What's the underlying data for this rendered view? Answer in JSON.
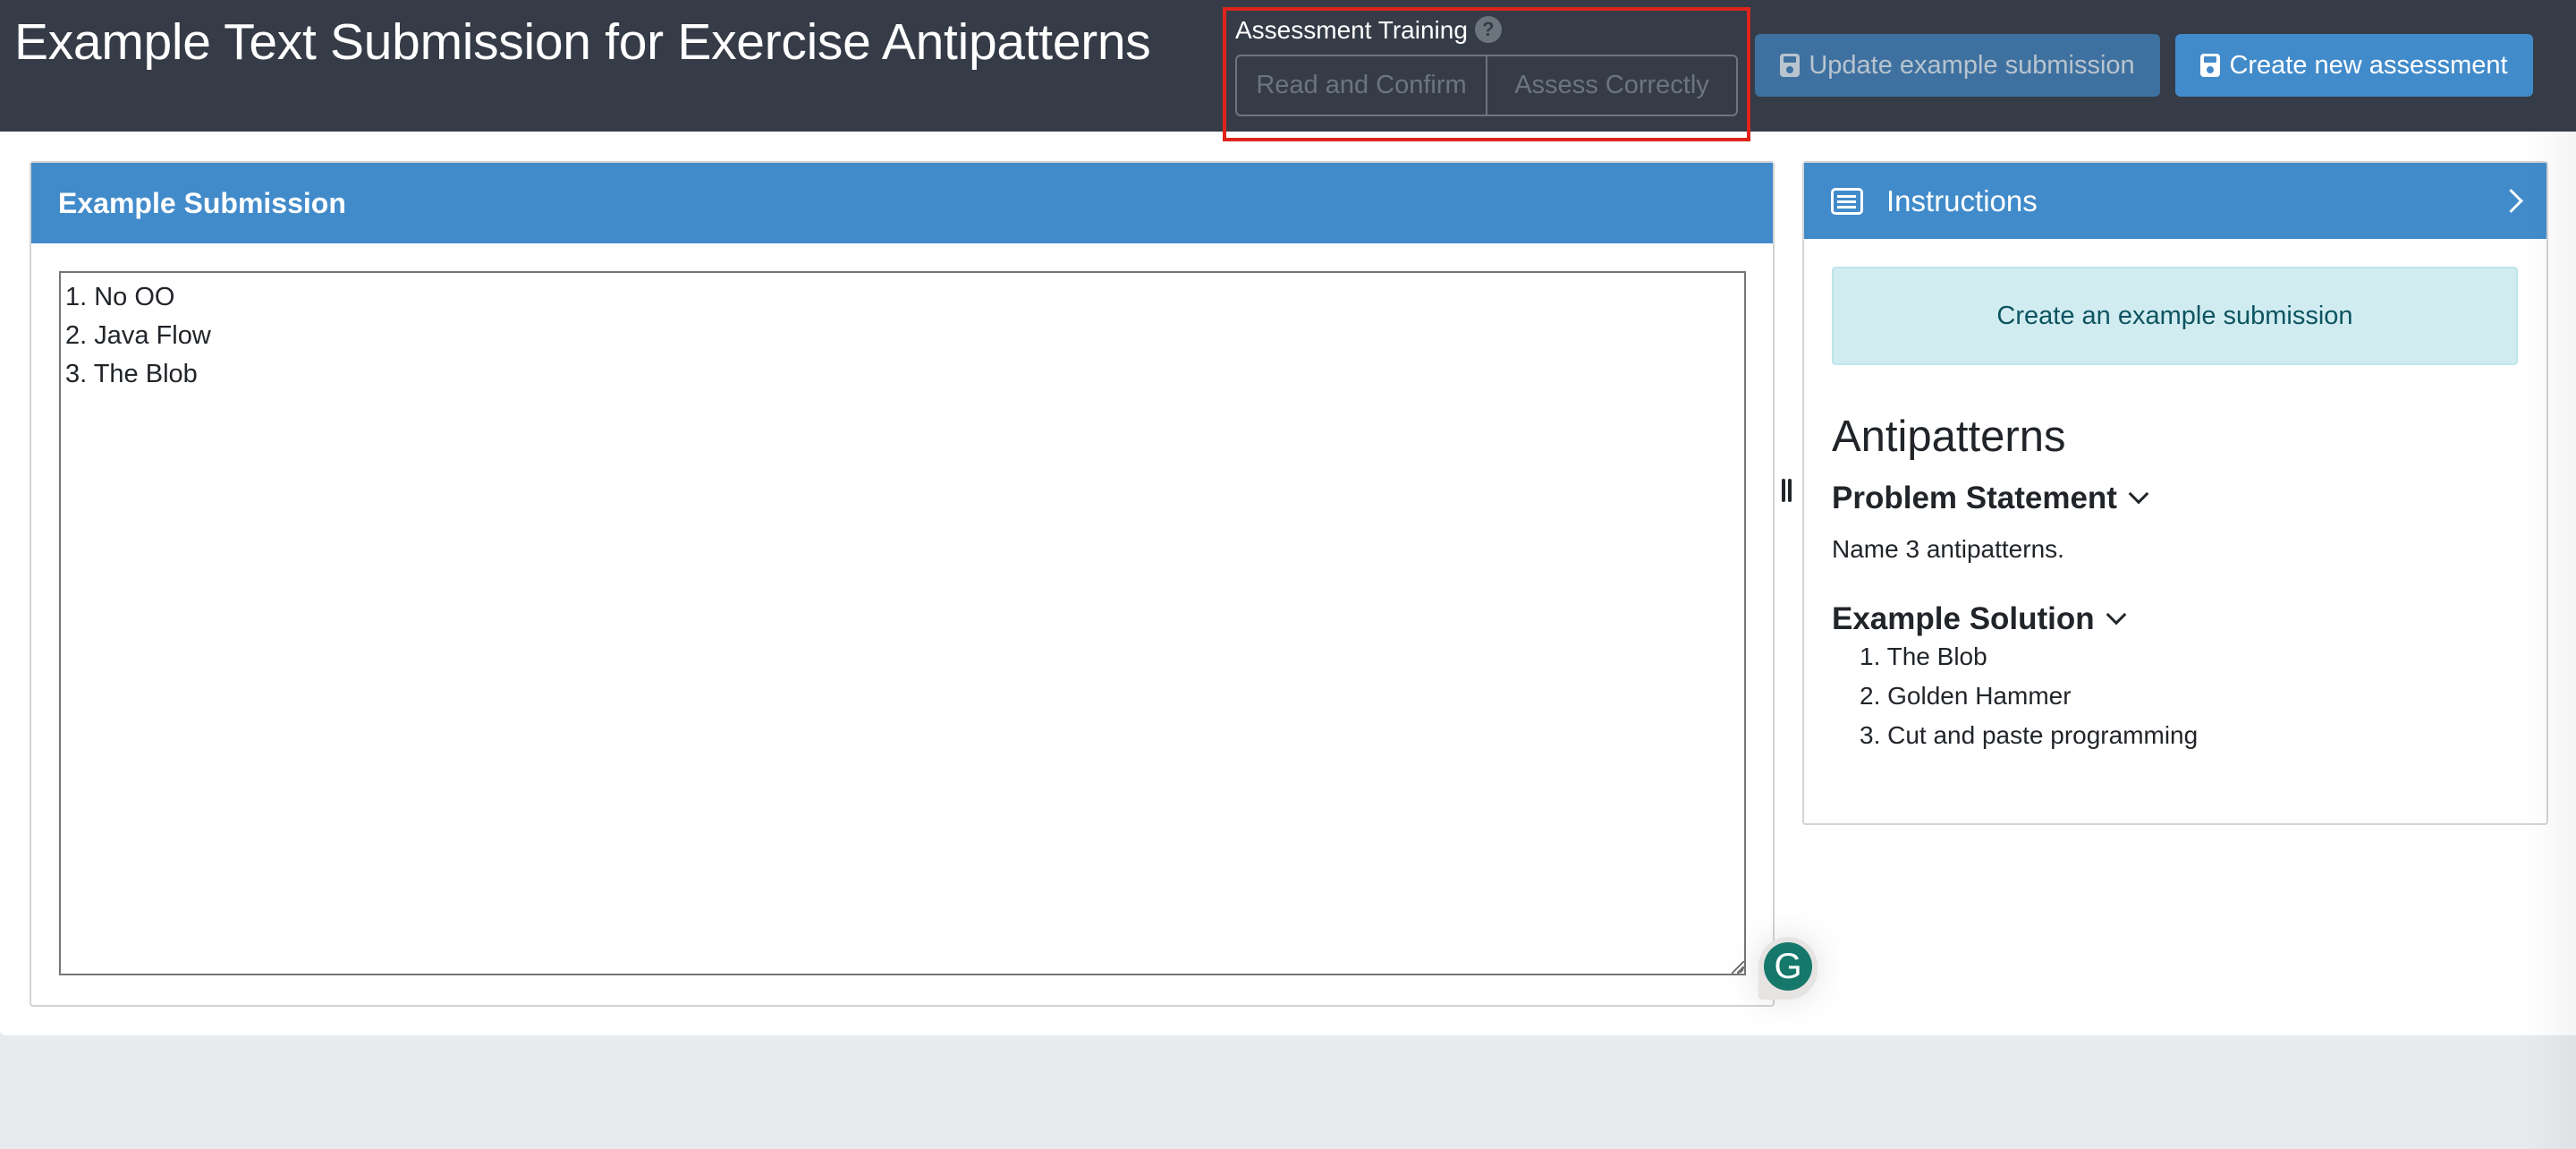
{
  "header": {
    "title": "Example Text Submission for Exercise Antipatterns",
    "assessment_training": {
      "label": "Assessment Training",
      "help_icon": "question-circle-icon",
      "buttons": [
        "Read and Confirm",
        "Assess Correctly"
      ]
    },
    "update_button": "Update example submission",
    "create_button": "Create new assessment",
    "button_icon": "save-icon"
  },
  "example_submission": {
    "title": "Example Submission",
    "text": "1. No OO\n2. Java Flow\n3. The Blob"
  },
  "instructions": {
    "title": "Instructions",
    "icon": "list-alt-icon",
    "alert": "Create an example submission",
    "exercise_title": "Antipatterns",
    "problem_statement": {
      "title": "Problem Statement",
      "text": "Name 3 antipatterns."
    },
    "example_solution": {
      "title": "Example Solution",
      "items": [
        "1. The Blob",
        "2. Golden Hammer",
        "3. Cut and paste programming"
      ]
    }
  },
  "colors": {
    "header_bg": "#353c47",
    "primary": "#428bca",
    "primary_disabled": "#3e71a0",
    "highlight": "#e0241b",
    "info_bg": "#d1ecf1",
    "info_text": "#0c5460",
    "grammarly": "#15786a",
    "page_bg": "#e7ebee"
  }
}
